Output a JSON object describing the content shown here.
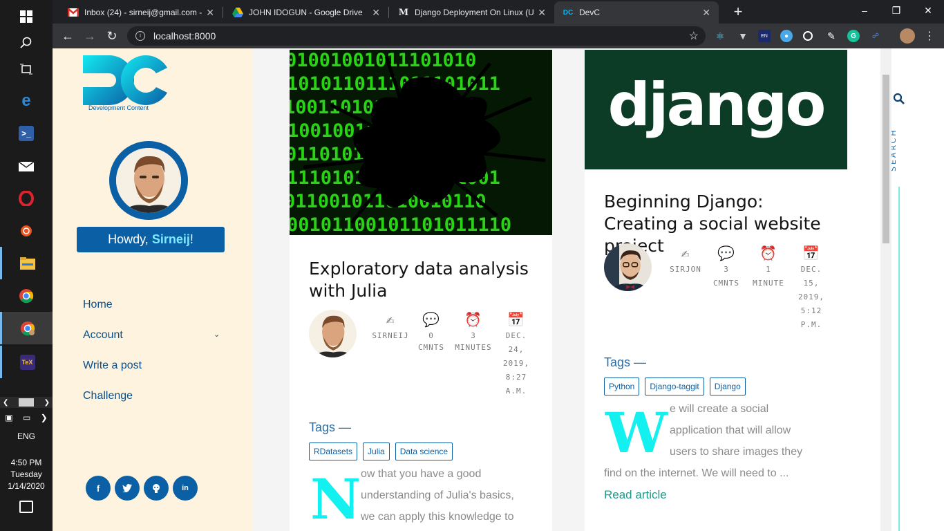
{
  "taskbar": {
    "language": "ENG",
    "time": "4:50 PM",
    "day": "Tuesday",
    "date": "1/14/2020",
    "icons": [
      "windows-start-icon",
      "search-icon",
      "task-view-icon",
      "edge-icon",
      "powershell-icon",
      "mail-icon",
      "opera-icon",
      "ubuntu-icon",
      "file-explorer-icon",
      "chrome-icon",
      "chrome-profile-icon",
      "texstudio-icon"
    ]
  },
  "browser": {
    "tabs": [
      {
        "title": "Inbox (24) - sirneij@gmail.com -",
        "icon": "gmail-icon"
      },
      {
        "title": "JOHN IDOGUN - Google Drive",
        "icon": "google-drive-icon"
      },
      {
        "title": "Django Deployment On Linux (U",
        "icon": "medium-icon"
      },
      {
        "title": "DevC",
        "icon": "devc-icon"
      }
    ],
    "active_tab": 3,
    "url": "localhost:8000"
  },
  "sidebar": {
    "logo_text": "Development Content",
    "greeting_prefix": "Howdy,",
    "username": "Sirneij",
    "greeting_suffix": "!",
    "nav": [
      {
        "label": "Home"
      },
      {
        "label": "Account"
      },
      {
        "label": "Write a post"
      },
      {
        "label": "Challenge"
      }
    ],
    "social": [
      "facebook-icon",
      "twitter-icon",
      "github-icon",
      "linkedin-icon"
    ]
  },
  "posts": [
    {
      "title": "Exploratory data analysis with Julia",
      "author": "SIRNEIJ",
      "comments": "0",
      "comments_label": "CMNTS",
      "read_time": "3",
      "read_label": "MINUTES",
      "date": [
        "DEC.",
        "24,",
        "2019,",
        "8:27",
        "A.M."
      ],
      "tags_heading": "Tags —",
      "tags": [
        "RDatasets",
        "Julia",
        "Data science"
      ],
      "dropcap": "N",
      "excerpt_first": "ow that you have a good",
      "excerpt_lines": [
        "understanding of Julia's basics,",
        "we can apply this knowledge to"
      ]
    },
    {
      "title": "Beginning Django: Creating a social website project",
      "author": "SIRJON",
      "comments": "3",
      "comments_label": "CMNTS",
      "read_time": "1",
      "read_label": "MINUTE",
      "date": [
        "DEC.",
        "15,",
        "2019,",
        "5:12",
        "P.M."
      ],
      "tags_heading": "Tags —",
      "tags": [
        "Python",
        "Django-taggit",
        "Django"
      ],
      "dropcap": "W",
      "excerpt_first": "e will create a social",
      "excerpt_lines": [
        "application that will allow",
        "users to share images they"
      ],
      "excerpt_tail": "find on the internet. We will need to ...",
      "read_more": "Read article",
      "banner_word": "django"
    }
  ],
  "search": {
    "label": "SEARCH"
  },
  "colors": {
    "brand_blue": "#0b5fa5",
    "cyan_accent": "#13f0f0",
    "sidebar_bg": "#fdf3de",
    "django_green": "#0c3c26"
  }
}
